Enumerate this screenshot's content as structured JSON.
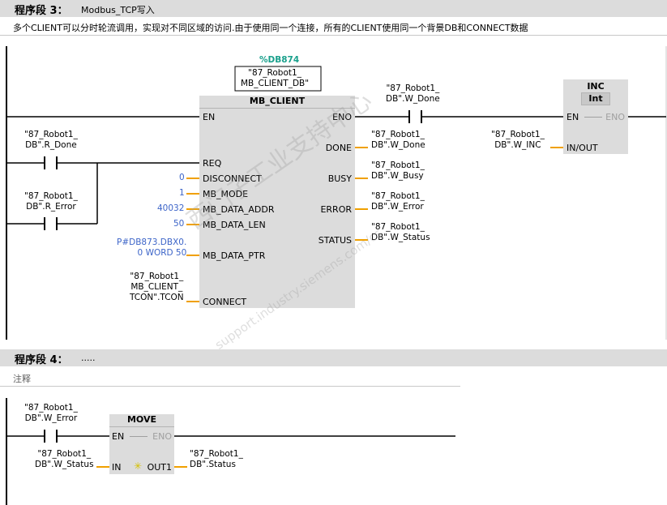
{
  "network3": {
    "title": "程序段 3：",
    "subtitle": "Modbus_TCP写入",
    "comment": "多个CLIENT可以分时轮流调用，实现对不同区域的访问.由于使用同一个连接，所有的CLIENT使用同一个背景DB和CONNECT数据",
    "contact_r_done": "\"87_Robot1_\nDB\".R_Done",
    "contact_r_error": "\"87_Robot1_\nDB\".R_Error",
    "instance_db_number": "%DB874",
    "instance_db_name": "\"87_Robot1_\nMB_CLIENT_DB\"",
    "mb_client": {
      "title": "MB_CLIENT",
      "en": "EN",
      "eno": "ENO",
      "req": "REQ",
      "disconnect": "DISCONNECT",
      "mb_mode": "MB_MODE",
      "mb_data_addr": "MB_DATA_ADDR",
      "mb_data_len": "MB_DATA_LEN",
      "mb_data_ptr": "MB_DATA_PTR",
      "connect": "CONNECT",
      "done": "DONE",
      "busy": "BUSY",
      "error": "ERROR",
      "status": "STATUS"
    },
    "inputs": {
      "disconnect_val": "0",
      "mb_mode_val": "1",
      "mb_data_addr_val": "40032",
      "mb_data_len_val": "50",
      "mb_data_ptr_val": "P#DB873.DBX0.\n0 WORD 50",
      "connect_val": "\"87_Robot1_\nMB_CLIENT_\nTCON\".TCON"
    },
    "outputs": {
      "done_var": "\"87_Robot1_\nDB\".W_Done",
      "busy_var": "\"87_Robot1_\nDB\".W_Busy",
      "error_var": "\"87_Robot1_\nDB\".W_Error",
      "status_var": "\"87_Robot1_\nDB\".W_Status"
    },
    "contact_w_done": "\"87_Robot1_\nDB\".W_Done",
    "inc": {
      "title": "INC",
      "type": "Int",
      "en": "EN",
      "eno": "ENO",
      "inout": "IN/OUT",
      "var": "\"87_Robot1_\nDB\".W_INC"
    }
  },
  "network4": {
    "title": "程序段 4：",
    "subtitle": ".....",
    "comment": "注释",
    "contact_w_error": "\"87_Robot1_\nDB\".W_Error",
    "move": {
      "title": "MOVE",
      "en": "EN",
      "eno": "ENO",
      "in": "IN",
      "out1": "OUT1",
      "in_var": "\"87_Robot1_\nDB\".W_Status",
      "out_var": "\"87_Robot1_\nDB\".Status"
    }
  },
  "watermark": {
    "line1": "西门子工业支持中心",
    "line2": "support.industry.siemens.com/cs"
  },
  "colors": {
    "header_bg": "#dcdcdc",
    "block_bg": "#dcdcdc",
    "pin_line": "#f0a000",
    "constant": "#3c64c8",
    "db_number": "#1aa08c"
  }
}
